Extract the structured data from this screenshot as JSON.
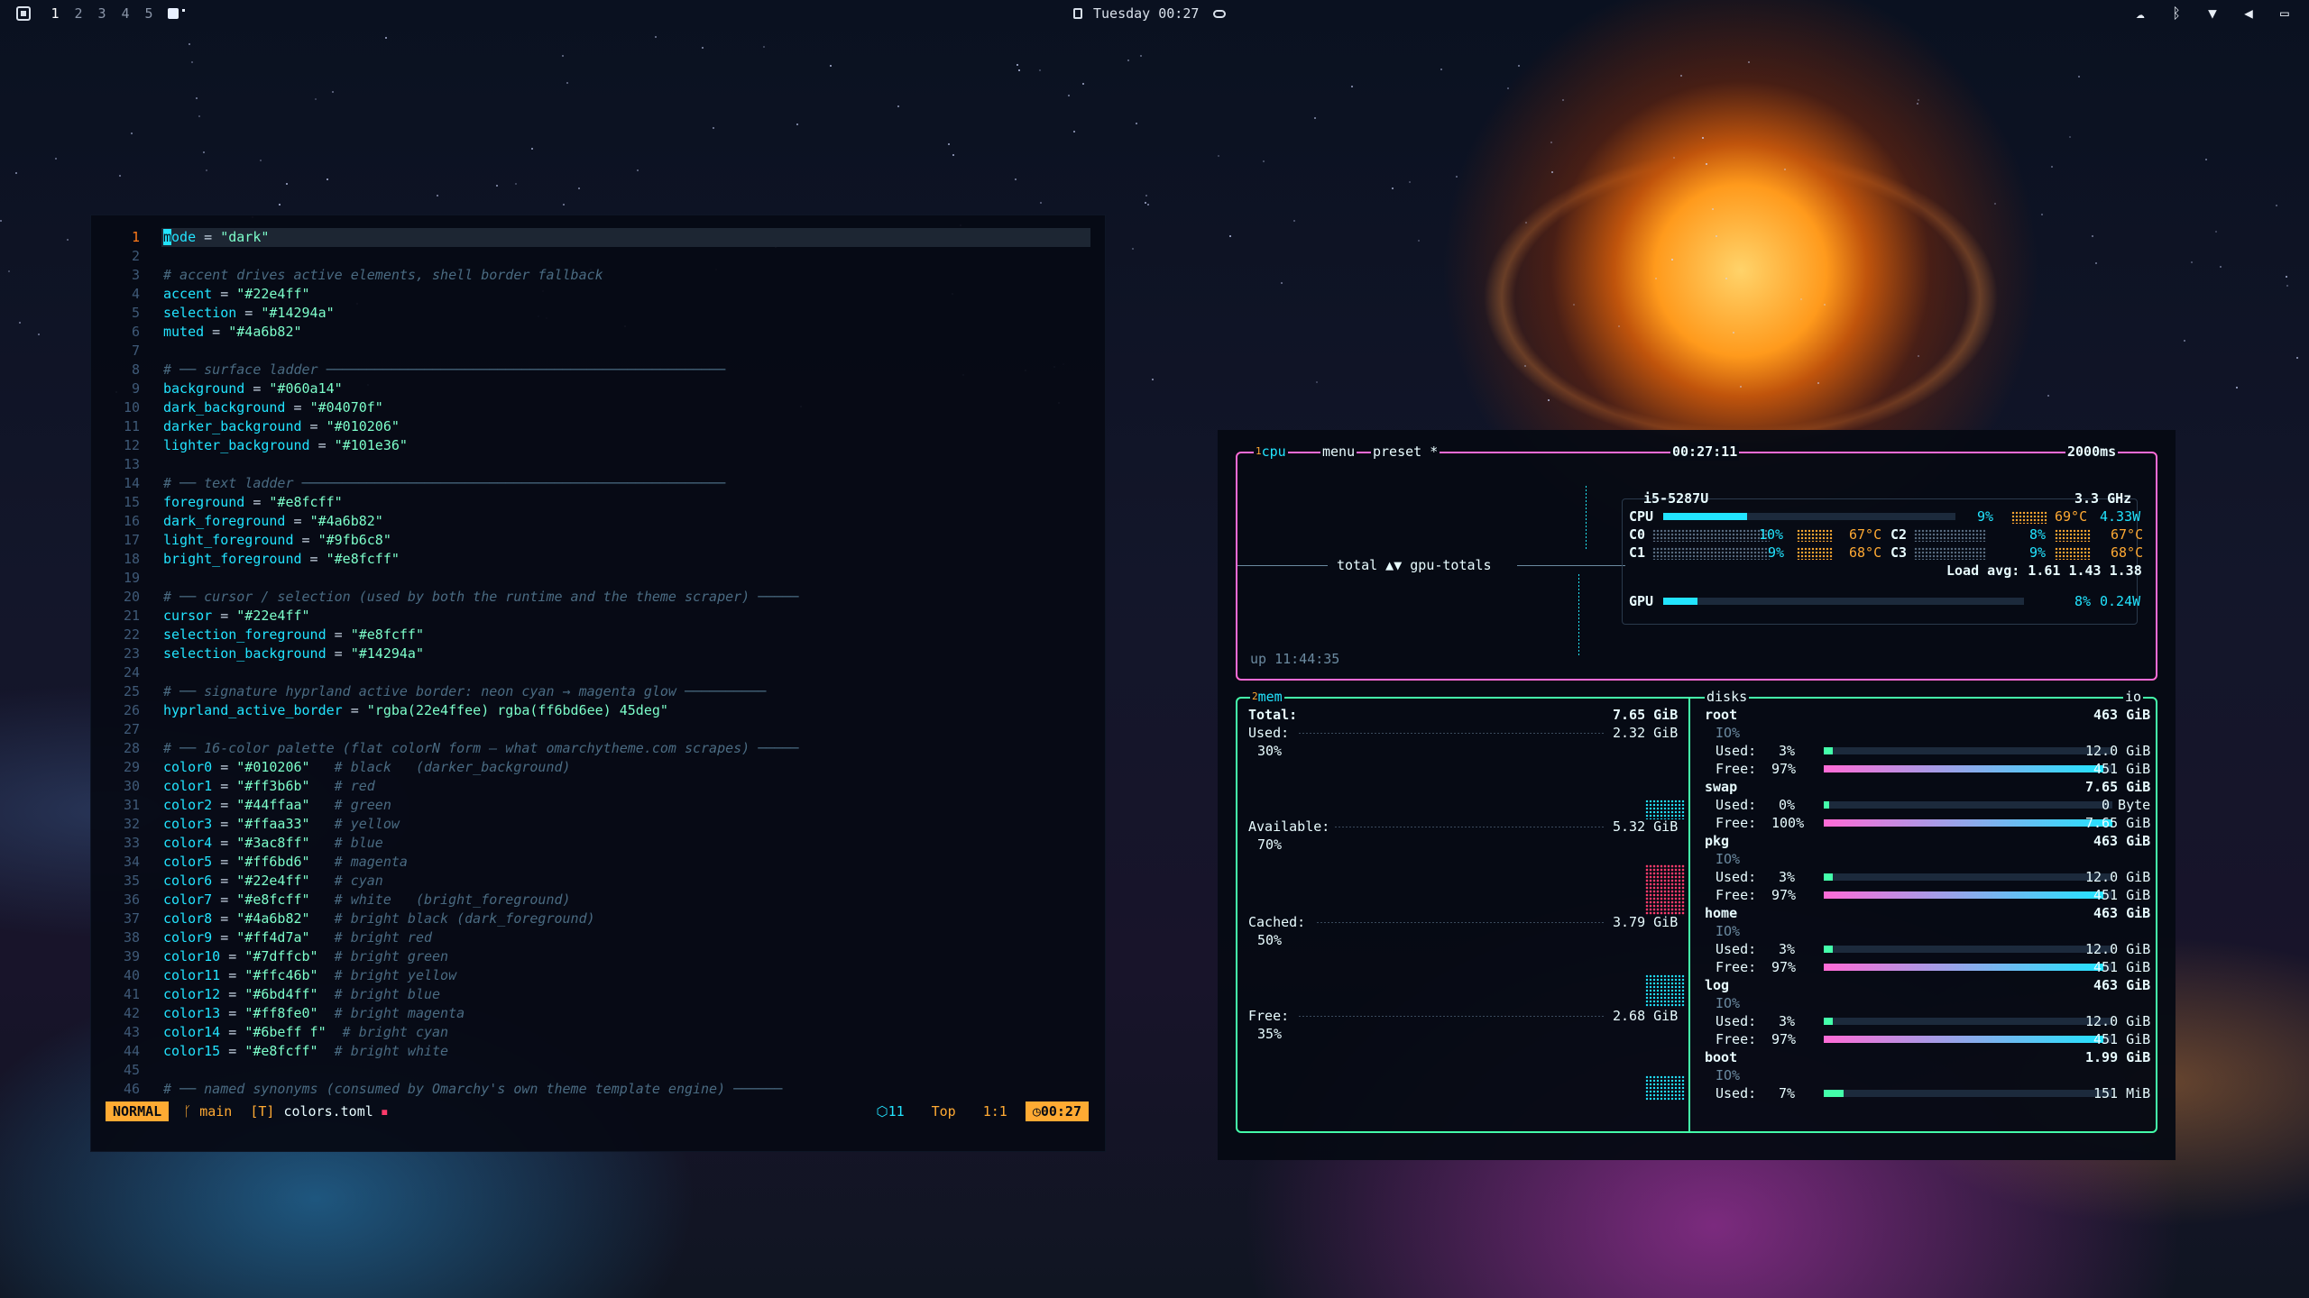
{
  "topbar": {
    "workspaces": [
      "1",
      "2",
      "3",
      "4",
      "5"
    ],
    "active_workspace": "1",
    "clock": "Tuesday 00:27",
    "tray_icons": [
      "cloud-icon",
      "bluetooth-icon",
      "wifi-icon",
      "volume-icon",
      "display-icon"
    ]
  },
  "editor": {
    "lines": [
      {
        "n": "1",
        "text": "mode = \"dark\""
      },
      {
        "n": "2",
        "text": ""
      },
      {
        "n": "3",
        "text": "# accent drives active elements, shell border fallback"
      },
      {
        "n": "4",
        "text": "accent = \"#22e4ff\""
      },
      {
        "n": "5",
        "text": "selection = \"#14294a\""
      },
      {
        "n": "6",
        "text": "muted = \"#4a6b82\""
      },
      {
        "n": "7",
        "text": ""
      },
      {
        "n": "8",
        "text": "# ── surface ladder ─────────────────────────────────────────────────"
      },
      {
        "n": "9",
        "text": "background = \"#060a14\""
      },
      {
        "n": "10",
        "text": "dark_background = \"#04070f\""
      },
      {
        "n": "11",
        "text": "darker_background = \"#010206\""
      },
      {
        "n": "12",
        "text": "lighter_background = \"#101e36\""
      },
      {
        "n": "13",
        "text": ""
      },
      {
        "n": "14",
        "text": "# ── text ladder ────────────────────────────────────────────────────"
      },
      {
        "n": "15",
        "text": "foreground = \"#e8fcff\""
      },
      {
        "n": "16",
        "text": "dark_foreground = \"#4a6b82\""
      },
      {
        "n": "17",
        "text": "light_foreground = \"#9fb6c8\""
      },
      {
        "n": "18",
        "text": "bright_foreground = \"#e8fcff\""
      },
      {
        "n": "19",
        "text": ""
      },
      {
        "n": "20",
        "text": "# ── cursor / selection (used by both the runtime and the theme scraper) ─────"
      },
      {
        "n": "21",
        "text": "cursor = \"#22e4ff\""
      },
      {
        "n": "22",
        "text": "selection_foreground = \"#e8fcff\""
      },
      {
        "n": "23",
        "text": "selection_background = \"#14294a\""
      },
      {
        "n": "24",
        "text": ""
      },
      {
        "n": "25",
        "text": "# ── signature hyprland active border: neon cyan → magenta glow ──────────"
      },
      {
        "n": "26",
        "text": "hyprland_active_border = \"rgba(22e4ffee) rgba(ff6bd6ee) 45deg\""
      },
      {
        "n": "27",
        "text": ""
      },
      {
        "n": "28",
        "text": "# ── 16-color palette (flat colorN form — what omarchytheme.com scrapes) ─────"
      },
      {
        "n": "29",
        "text": "color0 = \"#010206\"   # black   (darker_background)"
      },
      {
        "n": "30",
        "text": "color1 = \"#ff3b6b\"   # red"
      },
      {
        "n": "31",
        "text": "color2 = \"#44ffaa\"   # green"
      },
      {
        "n": "32",
        "text": "color3 = \"#ffaa33\"   # yellow"
      },
      {
        "n": "33",
        "text": "color4 = \"#3ac8ff\"   # blue"
      },
      {
        "n": "34",
        "text": "color5 = \"#ff6bd6\"   # magenta"
      },
      {
        "n": "35",
        "text": "color6 = \"#22e4ff\"   # cyan"
      },
      {
        "n": "36",
        "text": "color7 = \"#e8fcff\"   # white   (bright_foreground)"
      },
      {
        "n": "37",
        "text": "color8 = \"#4a6b82\"   # bright black (dark_foreground)"
      },
      {
        "n": "38",
        "text": "color9 = \"#ff4d7a\"   # bright red"
      },
      {
        "n": "39",
        "text": "color10 = \"#7dffcb\"  # bright green"
      },
      {
        "n": "40",
        "text": "color11 = \"#ffc46b\"  # bright yellow"
      },
      {
        "n": "41",
        "text": "color12 = \"#6bd4ff\"  # bright blue"
      },
      {
        "n": "42",
        "text": "color13 = \"#ff8fe0\"  # bright magenta"
      },
      {
        "n": "43",
        "text": "color14 = \"#6beff f\"  # bright cyan"
      },
      {
        "n": "44",
        "text": "color15 = \"#e8fcff\"  # bright white"
      },
      {
        "n": "45",
        "text": ""
      },
      {
        "n": "46",
        "text": "# ── named synonyms (consumed by Omarchy's own theme template engine) ──────"
      }
    ],
    "status": {
      "mode": "NORMAL",
      "branch": "main",
      "filetype": "[T]",
      "filename": "colors.toml",
      "diagnostics": "11",
      "position_label": "Top",
      "line_col": "1:1",
      "time": "00:27"
    }
  },
  "btop": {
    "cpu_header": {
      "tab_cpu": "cpu",
      "tab_cpu_num": "1",
      "tab_menu": "menu",
      "tab_preset": "preset *",
      "clock": "00:27:11",
      "interval": "2000ms"
    },
    "graph_label": "total ▲▼ gpu-totals",
    "uptime": "up 11:44:35",
    "cpu_model": "i5-5287U",
    "cpu_freq": "3.3 GHz",
    "cpu_total": {
      "label": "CPU",
      "pct": "9%",
      "pct_value": 0.09,
      "temp": "69°C",
      "power": "4.33W"
    },
    "cores": [
      {
        "label": "C0",
        "pct": "10%",
        "temp": "67°C"
      },
      {
        "label": "C1",
        "pct": "9%",
        "temp": "68°C"
      },
      {
        "label": "C2",
        "pct": "8%",
        "temp": "67°C"
      },
      {
        "label": "C3",
        "pct": "9%",
        "temp": "68°C"
      }
    ],
    "load_avg": "Load avg: 1.61 1.43 1.38",
    "gpu": {
      "label": "GPU",
      "pct": "8%",
      "pct_value": 0.08,
      "power": "0.24W"
    },
    "mem": {
      "tab": "mem",
      "tab_num": "2",
      "total_label": "Total:",
      "total": "7.65 GiB",
      "used_label": "Used:",
      "used": "2.32 GiB",
      "used_pct": "30%",
      "available_label": "Available:",
      "available": "5.32 GiB",
      "available_pct": "70%",
      "cached_label": "Cached:",
      "cached": "3.79 GiB",
      "cached_pct": "50%",
      "free_label": "Free:",
      "free": "2.68 GiB",
      "free_pct": "35%"
    },
    "disks_tab": "disks",
    "io_tab": "io",
    "disks": [
      {
        "name": "root",
        "size": "463 GiB",
        "io": "IO%",
        "used_pct": "3%",
        "used_value": 0.03,
        "used": "12.0 GiB",
        "free_pct": "97%",
        "free_value": 0.97,
        "free": "451 GiB"
      },
      {
        "name": "swap",
        "size": "7.65 GiB",
        "io": "",
        "used_pct": "0%",
        "used_value": 0.0,
        "used": "0 Byte",
        "free_pct": "100%",
        "free_value": 1.0,
        "free": "7.65 GiB"
      },
      {
        "name": "pkg",
        "size": "463 GiB",
        "io": "IO%",
        "used_pct": "3%",
        "used_value": 0.03,
        "used": "12.0 GiB",
        "free_pct": "97%",
        "free_value": 0.97,
        "free": "451 GiB"
      },
      {
        "name": "home",
        "size": "463 GiB",
        "io": "IO%",
        "used_pct": "3%",
        "used_value": 0.03,
        "used": "12.0 GiB",
        "free_pct": "97%",
        "free_value": 0.97,
        "free": "451 GiB"
      },
      {
        "name": "log",
        "size": "463 GiB",
        "io": "IO%",
        "used_pct": "3%",
        "used_value": 0.03,
        "used": "12.0 GiB",
        "free_pct": "97%",
        "free_value": 0.97,
        "free": "451 GiB"
      },
      {
        "name": "boot",
        "size": "1.99 GiB",
        "io": "IO%",
        "used_pct": "7%",
        "used_value": 0.07,
        "used": "151 MiB"
      }
    ],
    "labels": {
      "used": "Used:",
      "free": "Free:"
    }
  }
}
